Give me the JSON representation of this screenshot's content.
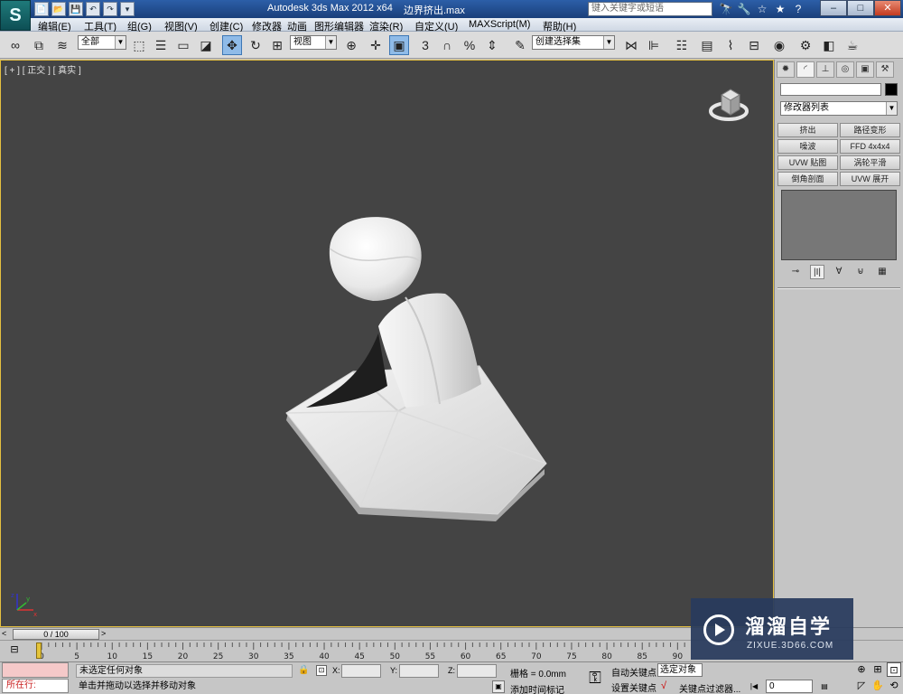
{
  "titlebar": {
    "app_title": "Autodesk 3ds Max  2012 x64",
    "file_name": "边界挤出.max",
    "search_placeholder": "键入关键字或短语",
    "logo_text": "S",
    "minimize": "–",
    "maximize": "□",
    "close": "✕",
    "quick_access": [
      "📄",
      "📂",
      "💾",
      "↶",
      "↷",
      "▾"
    ],
    "tools": [
      "🔭",
      "🔧",
      "☆",
      "★",
      "?"
    ]
  },
  "menu": [
    "编辑(E)",
    "工具(T)",
    "组(G)",
    "视图(V)",
    "创建(C)",
    "修改器",
    "动画",
    "图形编辑器",
    "渲染(R)",
    "自定义(U)",
    "MAXScript(M)",
    "帮助(H)"
  ],
  "toolbar": {
    "filter_dropdown": "全部",
    "refcoord_dropdown": "视图",
    "selection_set_dropdown": "创建选择集",
    "snap_labels": [
      "3",
      "%"
    ]
  },
  "viewport": {
    "label": "[ + ] [ 正交 ] [ 真实 ]",
    "axis_labels": {
      "x": "x",
      "y": "y",
      "z": "z"
    }
  },
  "command_panel": {
    "tabs": [
      "✹",
      "◜",
      "⊥",
      "◎",
      "▣",
      "⚒"
    ],
    "modifier_list": "修改器列表",
    "modifier_buttons": [
      "挤出",
      "路径变形",
      "噪波",
      "FFD 4x4x4",
      "UVW 贴图",
      "涡轮平滑",
      "倒角剖面",
      "UVW 展开"
    ],
    "stack_tools": [
      "⊸",
      "|I|",
      "∀",
      "⊌",
      "▦"
    ]
  },
  "timeline": {
    "frame_display": "0 / 100",
    "ticks": [
      "0",
      "5",
      "10",
      "15",
      "20",
      "25",
      "30",
      "35",
      "40",
      "45",
      "50",
      "55",
      "60",
      "65",
      "70",
      "75",
      "80",
      "85",
      "90"
    ]
  },
  "status": {
    "running_label": "所在行:",
    "selection_status": "未选定任何对象",
    "prompt": "单击并拖动以选择并移动对象",
    "coord_labels": [
      "X:",
      "Y:",
      "Z:"
    ],
    "grid": "栅格 = 0.0mm",
    "add_time_tag": "添加时间标记",
    "auto_key": "自动关键点",
    "set_key": "设置关键点",
    "selected_object": "选定对象",
    "key_filters": "关键点过滤器...",
    "current_frame": "0"
  },
  "watermark": {
    "title": "溜溜自学",
    "url": "ZIXUE.3D66.COM"
  },
  "colors": {
    "viewport_bg": "#444444",
    "active_border": "#e5c040",
    "watermark_bg": "#283a5c"
  }
}
